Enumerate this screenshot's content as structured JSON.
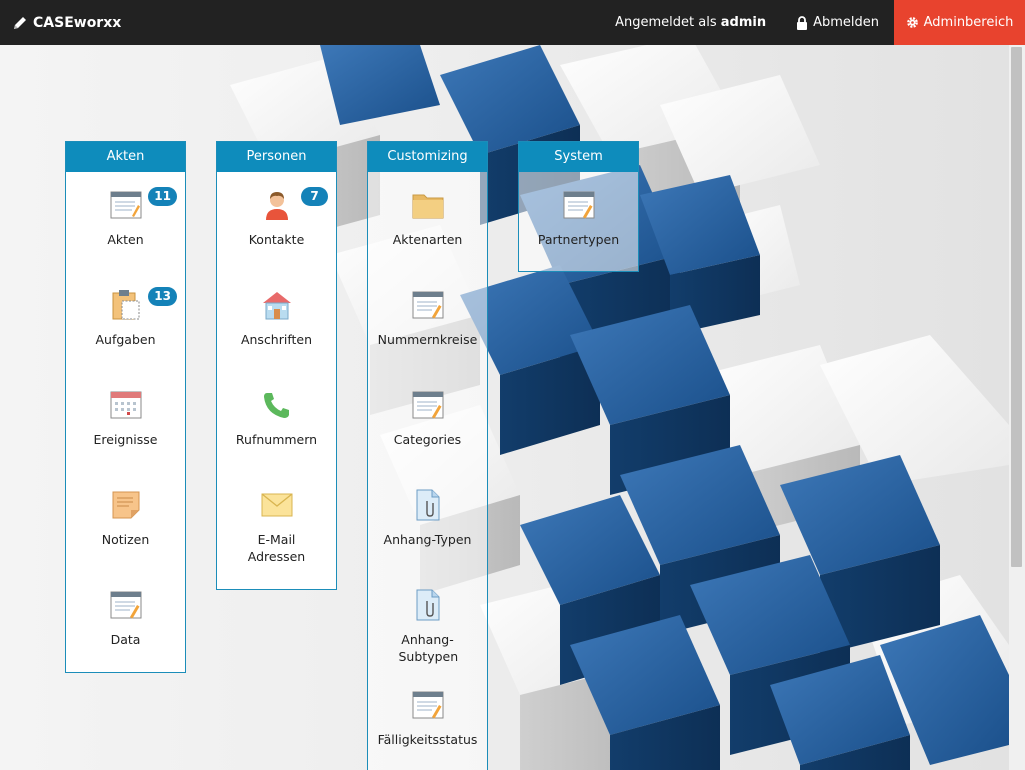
{
  "app": {
    "brand": "CASEworxx",
    "login_prefix": "Angemeldet als ",
    "user": "admin",
    "logout_label": "Abmelden",
    "admin_label": "Adminbereich"
  },
  "colors": {
    "topbar": "#222222",
    "accent": "#e8432e",
    "panel_header": "#0e8cbc",
    "badge": "#1482b8",
    "cube_blue": "#1d5894"
  },
  "panels": [
    {
      "title": "Akten",
      "items": [
        {
          "label": "Akten",
          "icon": "document-list-icon",
          "badge": "11"
        },
        {
          "label": "Aufgaben",
          "icon": "clipboard-icon",
          "badge": "13"
        },
        {
          "label": "Ereignisse",
          "icon": "calendar-icon"
        },
        {
          "label": "Notizen",
          "icon": "note-icon"
        },
        {
          "label": "Data",
          "icon": "document-edit-icon"
        }
      ]
    },
    {
      "title": "Personen",
      "items": [
        {
          "label": "Kontakte",
          "icon": "person-icon",
          "badge": "7"
        },
        {
          "label": "Anschriften",
          "icon": "house-icon"
        },
        {
          "label": "Rufnummern",
          "icon": "phone-icon"
        },
        {
          "label": "E-Mail Adressen",
          "icon": "envelope-icon"
        }
      ]
    },
    {
      "title": "Customizing",
      "items": [
        {
          "label": "Aktenarten",
          "icon": "folder-icon"
        },
        {
          "label": "Nummernkreise",
          "icon": "document-edit-icon"
        },
        {
          "label": "Categories",
          "icon": "document-edit-icon"
        },
        {
          "label": "Anhang-Typen",
          "icon": "attachment-file-icon"
        },
        {
          "label": "Anhang-Subtypen",
          "icon": "attachment-file-icon"
        },
        {
          "label": "Fälligkeitsstatus",
          "icon": "document-edit-icon"
        }
      ]
    },
    {
      "title": "System",
      "items": [
        {
          "label": "Partnertypen",
          "icon": "document-edit-icon"
        }
      ]
    }
  ]
}
